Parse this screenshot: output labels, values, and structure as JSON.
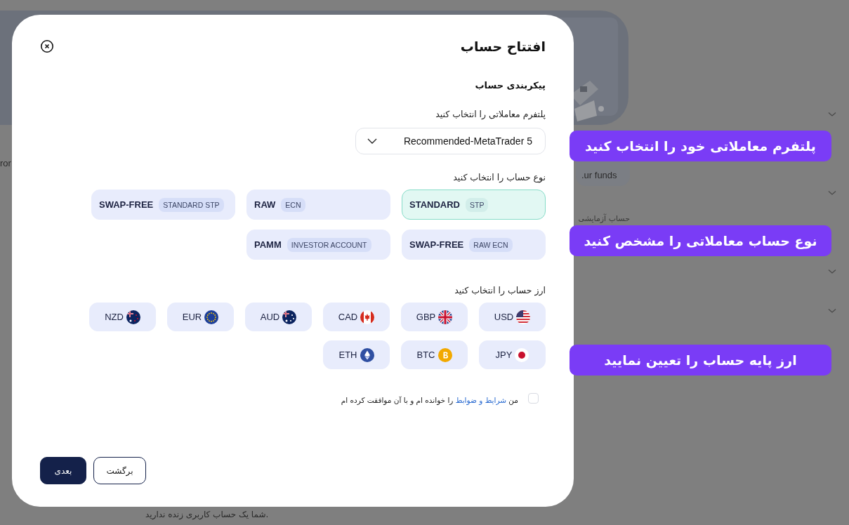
{
  "background": {
    "cut_text": "ror",
    "funds_text": ".ur funds",
    "demo_label": "حساب آزمایشی",
    "footer_text": "شما یک حساب کاربری زنده ندارید."
  },
  "modal": {
    "title": "افتتاح حساب",
    "section_title": "پیکربندی حساب",
    "platform_label": "پلتفرم معاملاتی را انتخاب کنید",
    "platform_value": "Recommended-MetaTrader 5",
    "account_type_label": "نوع حساب را انتخاب کنید",
    "account_types": [
      {
        "name": "STANDARD",
        "tag": "STP",
        "selected": true
      },
      {
        "name": "RAW",
        "tag": "ECN",
        "selected": false
      },
      {
        "name": "SWAP-FREE",
        "tag": "STANDARD STP",
        "selected": false
      },
      {
        "name": "SWAP-FREE",
        "tag": "RAW ECN",
        "selected": false
      },
      {
        "name": "PAMM",
        "tag": "INVESTOR ACCOUNT",
        "selected": false
      }
    ],
    "currency_label": "ارز حساب را انتخاب کنید",
    "currencies": [
      {
        "code": "USD",
        "kind": "us",
        "selected": false
      },
      {
        "code": "GBP",
        "kind": "gb",
        "selected": false
      },
      {
        "code": "CAD",
        "kind": "ca",
        "selected": false
      },
      {
        "code": "AUD",
        "kind": "au",
        "selected": false
      },
      {
        "code": "EUR",
        "kind": "eu",
        "selected": false
      },
      {
        "code": "NZD",
        "kind": "nz",
        "selected": false
      },
      {
        "code": "JPY",
        "kind": "jp",
        "selected": false
      },
      {
        "code": "BTC",
        "kind": "btc",
        "selected": false
      },
      {
        "code": "ETH",
        "kind": "eth",
        "selected": false
      }
    ],
    "terms": {
      "checked": false,
      "before": "من",
      "link": "شرایط و ضوابط",
      "after": "را خوانده ام و با آن موافقت کرده ام"
    },
    "buttons": [
      {
        "label": "برگشت",
        "kind": "secondary"
      },
      {
        "label": "بعدی",
        "kind": "primary"
      }
    ]
  },
  "callouts": [
    "پلتفرم معاملاتی خود را انتخاب کنید",
    "نوع حساب معاملاتی را مشخص کنید",
    "ارز پایه حساب را تعیین نمایید"
  ]
}
